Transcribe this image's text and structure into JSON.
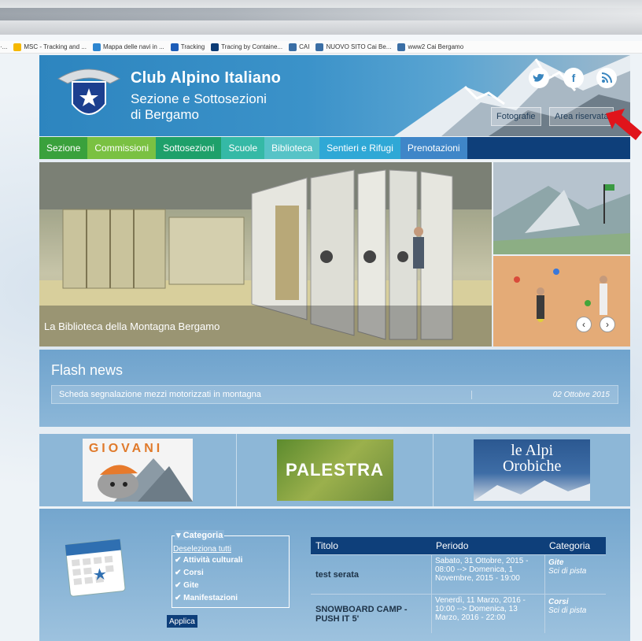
{
  "bookmarks": [
    {
      "label": "MSC - Tracking and ...",
      "color": "#f5b800"
    },
    {
      "label": "Mappa delle navi in ...",
      "color": "#2e86d0"
    },
    {
      "label": "Tracking",
      "color": "#1d5db8"
    },
    {
      "label": "Tracing by Containe...",
      "color": "#0c3b75"
    },
    {
      "label": "CAI",
      "color": "#3a6ea5"
    },
    {
      "label": "NUOVO SITO Cai Be...",
      "color": "#3a6ea5"
    },
    {
      "label": "www2 Cai Bergamo",
      "color": "#3a6ea5"
    }
  ],
  "header": {
    "title": "Club Alpino Italiano",
    "subtitle_line1": "Sezione e Sottosezioni",
    "subtitle_line2": "di Bergamo",
    "logo_text": "CLUB ALPINO ITALIANO",
    "buttons": {
      "photos": "Fotografie",
      "reserved": "Area riservata"
    },
    "social": {
      "twitter": "t",
      "facebook": "f",
      "rss": "rss"
    }
  },
  "nav": [
    {
      "label": "Sezione",
      "color": "#3aa13c"
    },
    {
      "label": "Commissioni",
      "color": "#7ac142"
    },
    {
      "label": "Sottosezioni",
      "color": "#1ea06a"
    },
    {
      "label": "Scuole",
      "color": "#35b9a6"
    },
    {
      "label": "Biblioteca",
      "color": "#57c3c7"
    },
    {
      "label": "Sentieri e Rifugi",
      "color": "#2fa8d6"
    },
    {
      "label": "Prenotazioni",
      "color": "#3f86c8"
    }
  ],
  "slider": {
    "caption": "La Biblioteca della Montagna Bergamo",
    "prev": "‹",
    "next": "›"
  },
  "flash": {
    "title": "Flash news",
    "item_text": "Scheda segnalazione mezzi motorizzati in montagna",
    "item_date": "02 Ottobre 2015"
  },
  "banners": {
    "giovani": "GIOVANI",
    "palestra": "PALESTRA",
    "alpi_line1": "le Alpi",
    "alpi_line2": "Orobiche"
  },
  "events": {
    "category_legend": "▾ Categoria",
    "deselect": "Deseleziona tutti",
    "categories": [
      "Attività culturali",
      "Corsi",
      "Gite",
      "Manifestazioni"
    ],
    "apply": "Applica",
    "table_headers": [
      "Titolo",
      "Periodo",
      "Categoria"
    ],
    "rows": [
      {
        "title": "test serata",
        "period": "Sabato, 31 Ottobre, 2015 - 08:00 --> Domenica, 1 Novembre, 2015 - 19:00",
        "category": "Gite",
        "subcategory": "Sci di pista"
      },
      {
        "title": "SNOWBOARD CAMP - PUSH IT 5'",
        "period": "Venerdì, 11 Marzo, 2016 - 10:00 --> Domenica, 13 Marzo, 2016 - 22:00",
        "category": "Corsi",
        "subcategory": "Sci di pista"
      }
    ]
  }
}
